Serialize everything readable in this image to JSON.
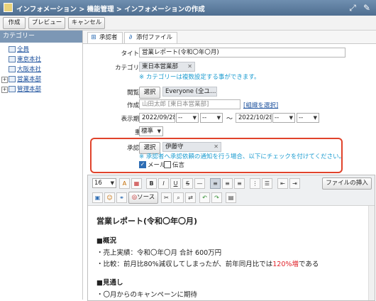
{
  "titlebar": {
    "breadcrumb": "インフォメーション > 機能管理 > インフォメーションの作成",
    "expand_icon": "expand-icon",
    "settings_icon": "wrench-icon"
  },
  "toolbar": {
    "create": "作成",
    "preview": "プレビュー",
    "cancel": "キャンセル"
  },
  "sidebar": {
    "header": "カテゴリー",
    "items": [
      {
        "label": "全員",
        "expandable": false
      },
      {
        "label": "東京本社",
        "expandable": false
      },
      {
        "label": "大阪本社",
        "expandable": false
      },
      {
        "label": "営業本部",
        "expandable": true
      },
      {
        "label": "管理本部",
        "expandable": true
      }
    ]
  },
  "tabs": [
    {
      "label": "承認者",
      "icon": "approver-icon"
    },
    {
      "label": "添付ファイル",
      "icon": "paperclip-icon"
    }
  ],
  "form": {
    "required_mark": "(*)",
    "colon": "：",
    "title": {
      "label": "タイトル",
      "value": "営業レポート(令和〇年〇月)"
    },
    "category": {
      "label": "カテゴリー",
      "chip": "東日本営業部",
      "note": "※ カテゴリーは複数設定する事ができます。"
    },
    "viewers": {
      "label": "閲覧先",
      "select_button": "選択",
      "chip": "Everyone (全ユ…"
    },
    "author": {
      "label": "作成者",
      "placeholder": "山田太郎 [東日本営業部]",
      "link": "[組織を選択]"
    },
    "period": {
      "label": "表示期間",
      "start_date": "2022/09/28",
      "start_h": "--",
      "start_m": "--",
      "tilde": "～",
      "end_date": "2022/10/28",
      "end_h": "--",
      "end_m": "--"
    },
    "priority": {
      "label": "重要度",
      "value": "標準"
    },
    "approver": {
      "label": "承認者",
      "select_button": "選択",
      "chip": "伊藤守",
      "note": "※ 承認者へ承認依頼の通知を行う場合、以下にチェックを付けてください。",
      "mail_label": "メール",
      "mail_checked": true,
      "message_label": "伝言",
      "message_checked": false
    }
  },
  "editor": {
    "font_size": "16",
    "source_label": "ソース",
    "insert_file_button": "ファイルの挿入",
    "content": {
      "heading": "営業レポート(令和〇年〇月)",
      "section1": "■概況",
      "line1": "・売上実績：令和〇年〇月 合計 600万円",
      "line2_a": "・比較：前月比80%減収してしまったが、前年同月比では",
      "line2_red": "120%増",
      "line2_b": "である",
      "section2": "■見通し",
      "line3": "・〇月からのキャンペーンに期待"
    }
  }
}
